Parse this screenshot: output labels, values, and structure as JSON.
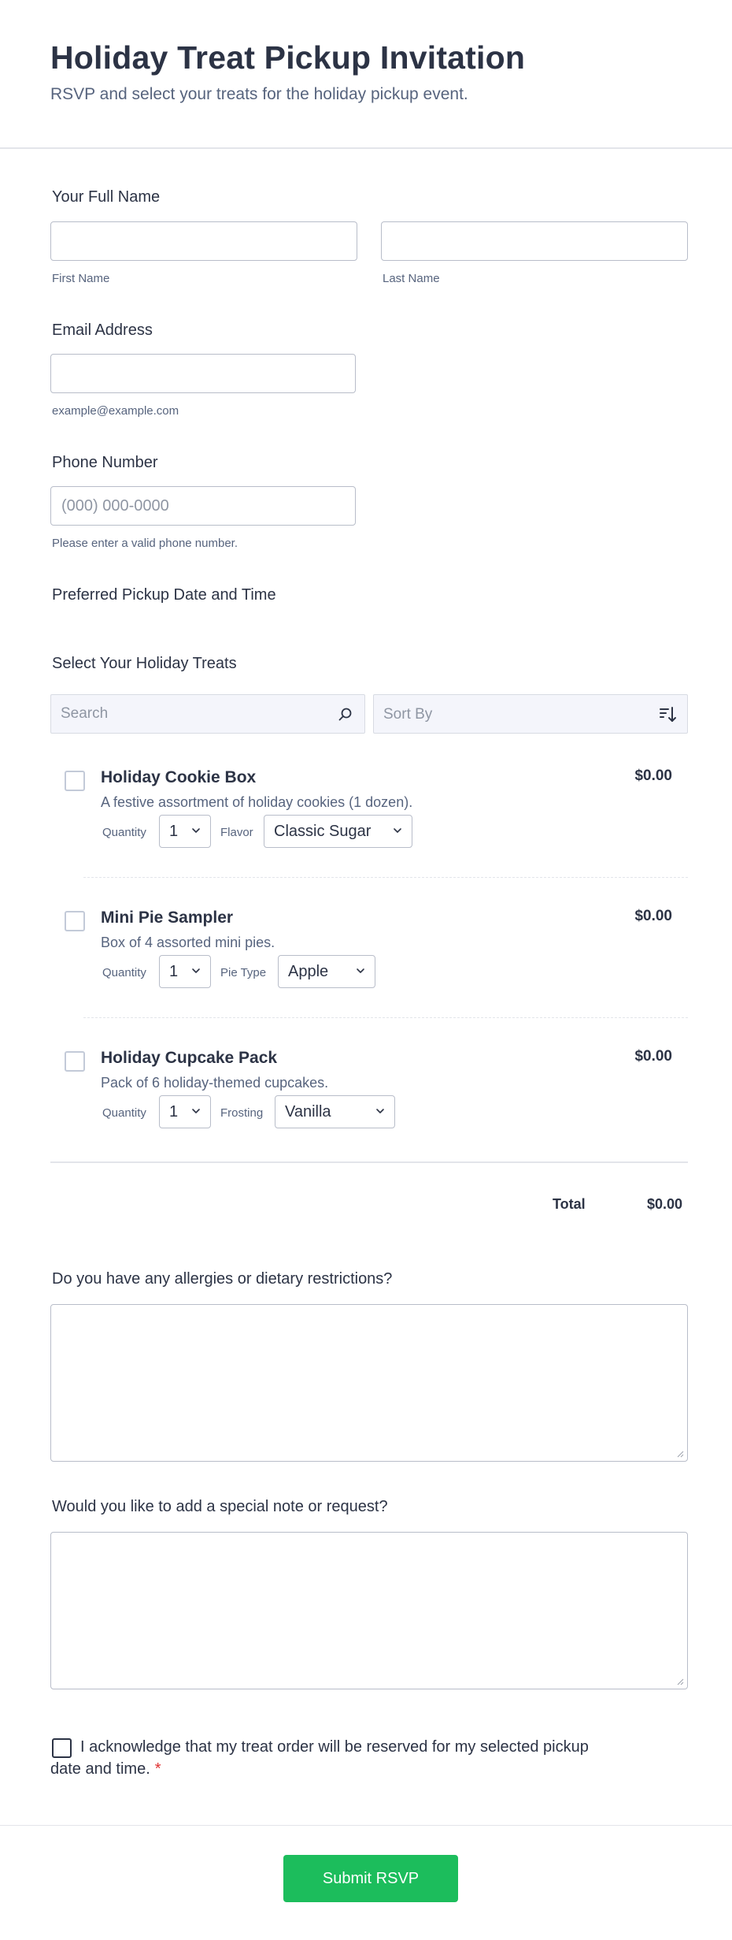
{
  "header": {
    "title": "Holiday Treat Pickup Invitation",
    "subtitle": "RSVP and select your treats for the holiday pickup event."
  },
  "full_name": {
    "label": "Your Full Name",
    "first_sublabel": "First Name",
    "last_sublabel": "Last Name",
    "first_value": "",
    "last_value": ""
  },
  "email": {
    "label": "Email Address",
    "value": "",
    "sublabel": "example@example.com"
  },
  "phone": {
    "label": "Phone Number",
    "placeholder": "(000) 000-0000",
    "value": "",
    "sublabel": "Please enter a valid phone number."
  },
  "pickup": {
    "label": "Preferred Pickup Date and Time"
  },
  "treats": {
    "label": "Select Your Holiday Treats",
    "search_placeholder": "Search",
    "sort_placeholder": "Sort By",
    "products": [
      {
        "name": "Holiday Cookie Box",
        "description": "A festive assortment of holiday cookies (1 dozen).",
        "price": "$0.00",
        "checked": false,
        "quantity_label": "Quantity",
        "quantity": "1",
        "option_label": "Flavor",
        "option_value": "Classic Sugar"
      },
      {
        "name": "Mini Pie Sampler",
        "description": "Box of 4 assorted mini pies.",
        "price": "$0.00",
        "checked": false,
        "quantity_label": "Quantity",
        "quantity": "1",
        "option_label": "Pie Type",
        "option_value": "Apple"
      },
      {
        "name": "Holiday Cupcake Pack",
        "description": "Pack of 6 holiday-themed cupcakes.",
        "price": "$0.00",
        "checked": false,
        "quantity_label": "Quantity",
        "quantity": "1",
        "option_label": "Frosting",
        "option_value": "Vanilla"
      }
    ],
    "total_label": "Total",
    "total_value": "$0.00"
  },
  "allergies": {
    "label": "Do you have any allergies or dietary restrictions?",
    "value": ""
  },
  "note": {
    "label": "Would you like to add a special note or request?",
    "value": ""
  },
  "acknowledge": {
    "text": "I acknowledge that my treat order will be reserved for my selected pickup date and time.",
    "required_mark": "*",
    "checked": false
  },
  "submit_label": "Submit RSVP",
  "colors": {
    "accent": "#1cbd5c",
    "text": "#2c3345",
    "muted": "#57647e",
    "required": "#e03131"
  },
  "icons": {
    "search": "search-icon",
    "sort": "sort-icon",
    "select": "chevron-down-icon"
  }
}
